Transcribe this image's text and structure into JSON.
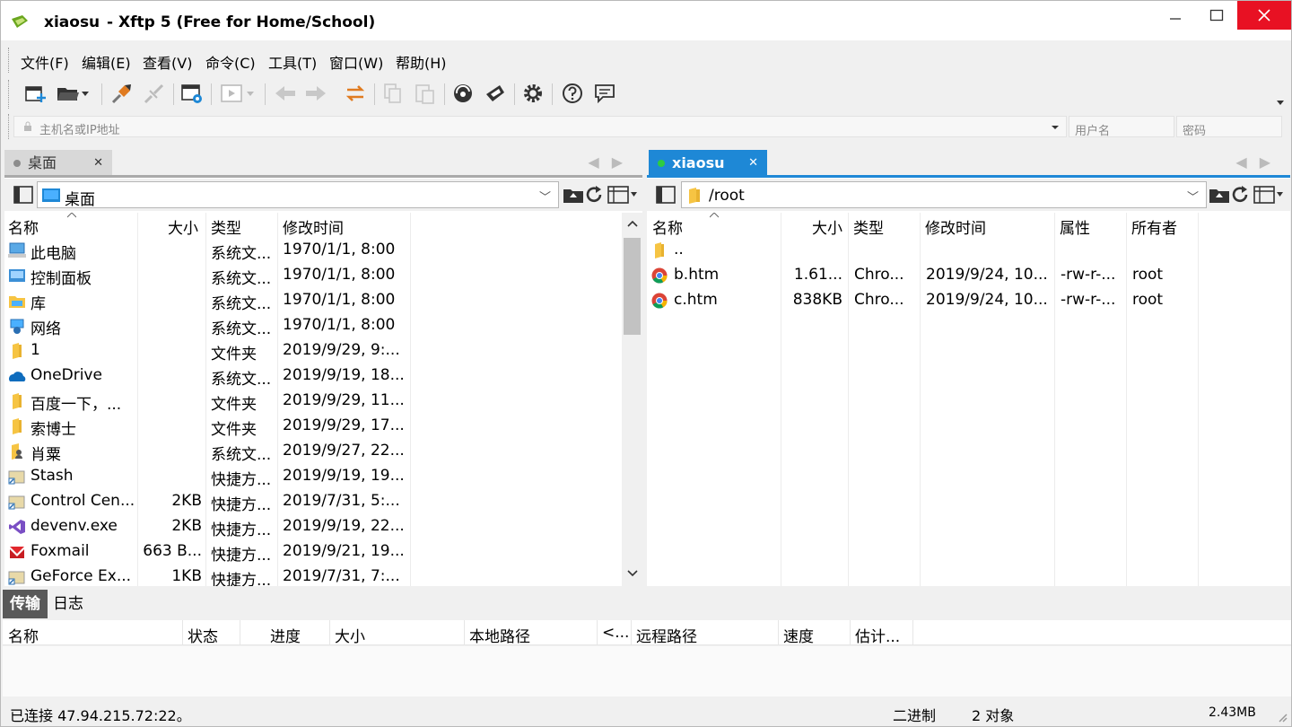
{
  "window": {
    "title_user": "xiaosu",
    "title_app": "- Xftp 5 (Free for Home/School)",
    "controls": {
      "min": "—",
      "max": "☐",
      "close": "✕"
    }
  },
  "menu": [
    "文件(F)",
    "编辑(E)",
    "查看(V)",
    "命令(C)",
    "工具(T)",
    "窗口(W)",
    "帮助(H)"
  ],
  "toolbar_icons": [
    "new-session-icon",
    "open-folder-icon",
    "dropdown-arrow-icon",
    "connect-icon",
    "disconnect-icon",
    "properties-icon",
    "transfer-icon",
    "dropdown-arrow-icon",
    "back-icon",
    "forward-icon",
    "sync-icon",
    "copy-icon",
    "paste-icon",
    "xshell-icon",
    "xftp-icon",
    "settings-icon",
    "help-icon",
    "feedback-icon"
  ],
  "address": {
    "host_placeholder": "主机名或IP地址",
    "user_placeholder": "用户名",
    "pass_placeholder": "密码"
  },
  "left": {
    "tab": "桌面",
    "path": "桌面",
    "columns": [
      "名称",
      "大小",
      "类型",
      "修改时间"
    ],
    "rows": [
      {
        "icon": "computer-icon",
        "name": "此电脑",
        "size": "",
        "type": "系统文...",
        "mtime": "1970/1/1, 8:00"
      },
      {
        "icon": "control-panel-icon",
        "name": "控制面板",
        "size": "",
        "type": "系统文...",
        "mtime": "1970/1/1, 8:00"
      },
      {
        "icon": "library-icon",
        "name": "库",
        "size": "",
        "type": "系统文...",
        "mtime": "1970/1/1, 8:00"
      },
      {
        "icon": "network-icon",
        "name": "网络",
        "size": "",
        "type": "系统文...",
        "mtime": "1970/1/1, 8:00"
      },
      {
        "icon": "folder-icon",
        "name": "1",
        "size": "",
        "type": "文件夹",
        "mtime": "2019/9/29, 9:..."
      },
      {
        "icon": "onedrive-icon",
        "name": "OneDrive",
        "size": "",
        "type": "系统文...",
        "mtime": "2019/9/19, 18..."
      },
      {
        "icon": "folder-icon",
        "name": "百度一下，...",
        "size": "",
        "type": "文件夹",
        "mtime": "2019/9/29, 11..."
      },
      {
        "icon": "folder-icon",
        "name": "索博士",
        "size": "",
        "type": "文件夹",
        "mtime": "2019/9/29, 17..."
      },
      {
        "icon": "user-folder-icon",
        "name": "肖粟",
        "size": "",
        "type": "系统文...",
        "mtime": "2019/9/27, 22..."
      },
      {
        "icon": "shortcut-icon",
        "name": "Stash",
        "size": "",
        "type": "快捷方...",
        "mtime": "2019/9/19, 19..."
      },
      {
        "icon": "shortcut-icon",
        "name": "Control Cen...",
        "size": "2KB",
        "type": "快捷方...",
        "mtime": "2019/7/31, 5:..."
      },
      {
        "icon": "visual-studio-icon",
        "name": "devenv.exe",
        "size": "2KB",
        "type": "快捷方...",
        "mtime": "2019/9/19, 22..."
      },
      {
        "icon": "foxmail-icon",
        "name": "Foxmail",
        "size": "663 B...",
        "type": "快捷方...",
        "mtime": "2019/9/21, 19..."
      },
      {
        "icon": "shortcut-icon",
        "name": "GeForce Ex...",
        "size": "1KB",
        "type": "快捷方...",
        "mtime": "2019/7/31, 7:..."
      }
    ]
  },
  "right": {
    "tab": "xiaosu",
    "path": "/root",
    "columns": [
      "名称",
      "大小",
      "类型",
      "修改时间",
      "属性",
      "所有者"
    ],
    "rows": [
      {
        "icon": "parent-folder-icon",
        "name": "..",
        "size": "",
        "type": "",
        "mtime": "",
        "attr": "",
        "owner": ""
      },
      {
        "icon": "chrome-icon",
        "name": "b.htm",
        "size": "1.61...",
        "type": "Chro...",
        "mtime": "2019/9/24, 10...",
        "attr": "-rw-r-...",
        "owner": "root"
      },
      {
        "icon": "chrome-icon",
        "name": "c.htm",
        "size": "838KB",
        "type": "Chro...",
        "mtime": "2019/9/24, 10...",
        "attr": "-rw-r-...",
        "owner": "root"
      }
    ]
  },
  "transfer": {
    "tabs": [
      "传输",
      "日志"
    ],
    "columns": [
      "名称",
      "状态",
      "进度",
      "大小",
      "本地路径",
      "<...",
      "远程路径",
      "速度",
      "估计..."
    ]
  },
  "status": {
    "connected": "已连接 47.94.215.72:22。",
    "mode": "二进制",
    "objects": "2 对象",
    "size": "2.43MB"
  },
  "colors": {
    "accent": "#1e88d6",
    "close": "#e81123",
    "tab_dark": "#595959"
  }
}
